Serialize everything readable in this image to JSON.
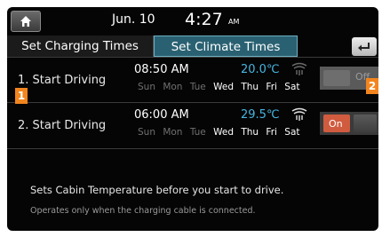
{
  "header": {
    "date": "Jun. 10",
    "time": "4:27",
    "ampm": "AM"
  },
  "tabs": [
    {
      "label": "Set Charging Times",
      "active": false
    },
    {
      "label": "Set Climate Times",
      "active": true
    }
  ],
  "schedules": [
    {
      "label": "1. Start Driving",
      "time": "08:50 AM",
      "temperature": "20.0℃",
      "days": [
        "Sun",
        "Mon",
        "Tue",
        "Wed",
        "Thu",
        "Fri",
        "Sat"
      ],
      "active_days": [
        "Wed",
        "Thu",
        "Fri",
        "Sat"
      ],
      "toggle": "Off",
      "enabled": false
    },
    {
      "label": "2. Start Driving",
      "time": "06:00 AM",
      "temperature": "29.5℃",
      "days": [
        "Sun",
        "Mon",
        "Tue",
        "Wed",
        "Thu",
        "Fri",
        "Sat"
      ],
      "active_days": [
        "Wed",
        "Thu",
        "Fri",
        "Sat"
      ],
      "toggle": "On",
      "enabled": true
    }
  ],
  "callouts": [
    "1",
    "2"
  ],
  "info": {
    "line1": "Sets Cabin Temperature before you start to drive.",
    "line2": "Operates only when the charging cable is connected."
  },
  "colors": {
    "accent_tab": "#2a6172",
    "temperature": "#47b5e0",
    "toggle_on": "#d05b3e",
    "callout": "#f2851e"
  },
  "icons": {
    "home": "home-icon",
    "back": "back-arrow-icon",
    "fan": "defrost-fan-icon"
  }
}
